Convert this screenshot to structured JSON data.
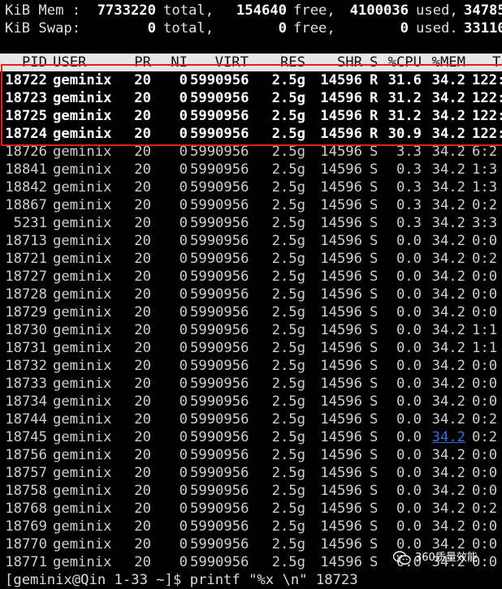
{
  "summary": {
    "mem": {
      "label": "KiB Mem :",
      "total": "7733220",
      "total_label": "total,",
      "free": "154640",
      "free_label": "free,",
      "used": "4100036",
      "used_label": "used,",
      "extra": "34785"
    },
    "swap": {
      "label": "KiB Swap:",
      "total": "0",
      "total_label": "total,",
      "free": "0",
      "free_label": "free,",
      "used": "0",
      "used_label": "used.",
      "extra": "33110"
    }
  },
  "table": {
    "headers": {
      "pid": "PID",
      "user": "USER",
      "pr": "PR",
      "ni": "NI",
      "virt": "VIRT",
      "res": "RES",
      "shr": "SHR",
      "s": "S",
      "cpu": "%CPU",
      "mem": "%MEM",
      "time": "T"
    },
    "rows": [
      {
        "pid": "18722",
        "user": "geminix",
        "pr": "20",
        "ni": "0",
        "virt": "5990956",
        "res": "2.5g",
        "shr": "14596",
        "s": "R",
        "cpu": "31.6",
        "mem": "34.2",
        "time": "122:4"
      },
      {
        "pid": "18723",
        "user": "geminix",
        "pr": "20",
        "ni": "0",
        "virt": "5990956",
        "res": "2.5g",
        "shr": "14596",
        "s": "R",
        "cpu": "31.2",
        "mem": "34.2",
        "time": "122:4"
      },
      {
        "pid": "18725",
        "user": "geminix",
        "pr": "20",
        "ni": "0",
        "virt": "5990956",
        "res": "2.5g",
        "shr": "14596",
        "s": "R",
        "cpu": "31.2",
        "mem": "34.2",
        "time": "122:4"
      },
      {
        "pid": "18724",
        "user": "geminix",
        "pr": "20",
        "ni": "0",
        "virt": "5990956",
        "res": "2.5g",
        "shr": "14596",
        "s": "R",
        "cpu": "30.9",
        "mem": "34.2",
        "time": "122:4"
      },
      {
        "pid": "18726",
        "user": "geminix",
        "pr": "20",
        "ni": "0",
        "virt": "5990956",
        "res": "2.5g",
        "shr": "14596",
        "s": "S",
        "cpu": "3.3",
        "mem": "34.2",
        "time": "6:2"
      },
      {
        "pid": "18841",
        "user": "geminix",
        "pr": "20",
        "ni": "0",
        "virt": "5990956",
        "res": "2.5g",
        "shr": "14596",
        "s": "S",
        "cpu": "0.3",
        "mem": "34.2",
        "time": "1:3"
      },
      {
        "pid": "18842",
        "user": "geminix",
        "pr": "20",
        "ni": "0",
        "virt": "5990956",
        "res": "2.5g",
        "shr": "14596",
        "s": "S",
        "cpu": "0.3",
        "mem": "34.2",
        "time": "1:3"
      },
      {
        "pid": "18867",
        "user": "geminix",
        "pr": "20",
        "ni": "0",
        "virt": "5990956",
        "res": "2.5g",
        "shr": "14596",
        "s": "S",
        "cpu": "0.3",
        "mem": "34.2",
        "time": "0:2"
      },
      {
        "pid": "5231",
        "user": "geminix",
        "pr": "20",
        "ni": "0",
        "virt": "5990956",
        "res": "2.5g",
        "shr": "14596",
        "s": "S",
        "cpu": "0.3",
        "mem": "34.2",
        "time": "3:3"
      },
      {
        "pid": "18713",
        "user": "geminix",
        "pr": "20",
        "ni": "0",
        "virt": "5990956",
        "res": "2.5g",
        "shr": "14596",
        "s": "S",
        "cpu": "0.0",
        "mem": "34.2",
        "time": "0:0"
      },
      {
        "pid": "18721",
        "user": "geminix",
        "pr": "20",
        "ni": "0",
        "virt": "5990956",
        "res": "2.5g",
        "shr": "14596",
        "s": "S",
        "cpu": "0.0",
        "mem": "34.2",
        "time": "0:2"
      },
      {
        "pid": "18727",
        "user": "geminix",
        "pr": "20",
        "ni": "0",
        "virt": "5990956",
        "res": "2.5g",
        "shr": "14596",
        "s": "S",
        "cpu": "0.0",
        "mem": "34.2",
        "time": "0:0"
      },
      {
        "pid": "18728",
        "user": "geminix",
        "pr": "20",
        "ni": "0",
        "virt": "5990956",
        "res": "2.5g",
        "shr": "14596",
        "s": "S",
        "cpu": "0.0",
        "mem": "34.2",
        "time": "0:0"
      },
      {
        "pid": "18729",
        "user": "geminix",
        "pr": "20",
        "ni": "0",
        "virt": "5990956",
        "res": "2.5g",
        "shr": "14596",
        "s": "S",
        "cpu": "0.0",
        "mem": "34.2",
        "time": "0:0"
      },
      {
        "pid": "18730",
        "user": "geminix",
        "pr": "20",
        "ni": "0",
        "virt": "5990956",
        "res": "2.5g",
        "shr": "14596",
        "s": "S",
        "cpu": "0.0",
        "mem": "34.2",
        "time": "1:1"
      },
      {
        "pid": "18731",
        "user": "geminix",
        "pr": "20",
        "ni": "0",
        "virt": "5990956",
        "res": "2.5g",
        "shr": "14596",
        "s": "S",
        "cpu": "0.0",
        "mem": "34.2",
        "time": "1:1"
      },
      {
        "pid": "18732",
        "user": "geminix",
        "pr": "20",
        "ni": "0",
        "virt": "5990956",
        "res": "2.5g",
        "shr": "14596",
        "s": "S",
        "cpu": "0.0",
        "mem": "34.2",
        "time": "0:0"
      },
      {
        "pid": "18733",
        "user": "geminix",
        "pr": "20",
        "ni": "0",
        "virt": "5990956",
        "res": "2.5g",
        "shr": "14596",
        "s": "S",
        "cpu": "0.0",
        "mem": "34.2",
        "time": "0:0"
      },
      {
        "pid": "18734",
        "user": "geminix",
        "pr": "20",
        "ni": "0",
        "virt": "5990956",
        "res": "2.5g",
        "shr": "14596",
        "s": "S",
        "cpu": "0.0",
        "mem": "34.2",
        "time": "0:0"
      },
      {
        "pid": "18744",
        "user": "geminix",
        "pr": "20",
        "ni": "0",
        "virt": "5990956",
        "res": "2.5g",
        "shr": "14596",
        "s": "S",
        "cpu": "0.0",
        "mem": "34.2",
        "time": "0:2"
      },
      {
        "pid": "18745",
        "user": "geminix",
        "pr": "20",
        "ni": "0",
        "virt": "5990956",
        "res": "2.5g",
        "shr": "14596",
        "s": "S",
        "cpu": "0.0",
        "mem": "34.2",
        "time": "0:2"
      },
      {
        "pid": "18756",
        "user": "geminix",
        "pr": "20",
        "ni": "0",
        "virt": "5990956",
        "res": "2.5g",
        "shr": "14596",
        "s": "S",
        "cpu": "0.0",
        "mem": "34.2",
        "time": "0:0"
      },
      {
        "pid": "18757",
        "user": "geminix",
        "pr": "20",
        "ni": "0",
        "virt": "5990956",
        "res": "2.5g",
        "shr": "14596",
        "s": "S",
        "cpu": "0.0",
        "mem": "34.2",
        "time": "0:0"
      },
      {
        "pid": "18758",
        "user": "geminix",
        "pr": "20",
        "ni": "0",
        "virt": "5990956",
        "res": "2.5g",
        "shr": "14596",
        "s": "S",
        "cpu": "0.0",
        "mem": "34.2",
        "time": "0:0"
      },
      {
        "pid": "18768",
        "user": "geminix",
        "pr": "20",
        "ni": "0",
        "virt": "5990956",
        "res": "2.5g",
        "shr": "14596",
        "s": "S",
        "cpu": "0.0",
        "mem": "34.2",
        "time": "0:2"
      },
      {
        "pid": "18769",
        "user": "geminix",
        "pr": "20",
        "ni": "0",
        "virt": "5990956",
        "res": "2.5g",
        "shr": "14596",
        "s": "S",
        "cpu": "0.0",
        "mem": "34.2",
        "time": "0:0"
      },
      {
        "pid": "18770",
        "user": "geminix",
        "pr": "20",
        "ni": "0",
        "virt": "5990956",
        "res": "2.5g",
        "shr": "14596",
        "s": "S",
        "cpu": "0.0",
        "mem": "34.2",
        "time": "0:0"
      },
      {
        "pid": "18771",
        "user": "geminix",
        "pr": "20",
        "ni": "0",
        "virt": "5990956",
        "res": "2.5g",
        "shr": "14596",
        "s": "S",
        "cpu": "0.0",
        "mem": "34.2",
        "time": "0:0"
      }
    ],
    "highlighted_row_count": 4,
    "link_row_index": 20
  },
  "command_line": "[geminix@Qin 1-33 ~]$ printf \"%x \\n\" 18723",
  "watermark": {
    "text": "360质量效能",
    "icon": "wechat-bubble-icon"
  },
  "colors": {
    "background": "#000000",
    "header_bar": "#e6e6e6",
    "highlight_box": "#d9231b",
    "link": "#3b6fd6"
  }
}
